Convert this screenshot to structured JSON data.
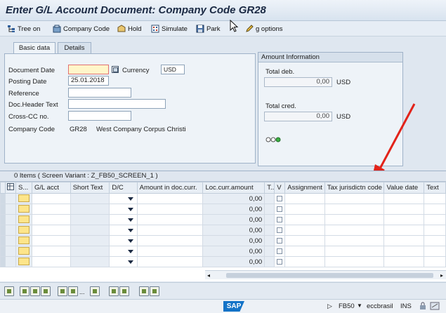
{
  "window": {
    "title": "Enter G/L Account Document: Company Code GR28"
  },
  "toolbar": {
    "tree_on": "Tree on",
    "company_code": "Company Code",
    "hold": "Hold",
    "simulate": "Simulate",
    "park": "Park",
    "options": "g options"
  },
  "tabs": {
    "basic_data": "Basic data",
    "details": "Details"
  },
  "basic": {
    "document_date_label": "Document Date",
    "document_date_value": "",
    "currency_label": "Currency",
    "currency_value": "USD",
    "posting_date_label": "Posting Date",
    "posting_date_value": "25.01.2018",
    "reference_label": "Reference",
    "reference_value": "",
    "doc_header_label": "Doc.Header Text",
    "doc_header_value": "",
    "cross_cc_label": "Cross-CC no.",
    "cross_cc_value": "",
    "company_code_label": "Company Code",
    "company_code_value": "GR28",
    "company_name": "West Company Corpus Christi"
  },
  "amount_info": {
    "title": "Amount Information",
    "total_deb_label": "Total deb.",
    "total_deb_value": "0,00",
    "total_deb_currency": "USD",
    "total_cred_label": "Total cred.",
    "total_cred_value": "0,00",
    "total_cred_currency": "USD"
  },
  "grid": {
    "caption": "0 Items ( Screen Variant : Z_FB50_SCREEN_1 )",
    "columns": [
      "S...",
      "G/L acct",
      "Short Text",
      "D/C",
      "Amount in doc.curr.",
      "Loc.curr.amount",
      "T..",
      "V",
      "Assignment",
      "Tax jurisdictn code",
      "Value date",
      "Text"
    ],
    "rows": [
      {
        "loc_amount": "0,00"
      },
      {
        "loc_amount": "0,00"
      },
      {
        "loc_amount": "0,00"
      },
      {
        "loc_amount": "0,00"
      },
      {
        "loc_amount": "0,00"
      },
      {
        "loc_amount": "0,00"
      },
      {
        "loc_amount": "0,00"
      }
    ]
  },
  "status_bar": {
    "transaction": "FB50",
    "system": "eccbrasil",
    "mode": "INS",
    "logo": "SAP"
  },
  "colors": {
    "annotation_arrow": "#e2231a",
    "required_field": "#fff6c9",
    "status_green": "#3cb043"
  }
}
